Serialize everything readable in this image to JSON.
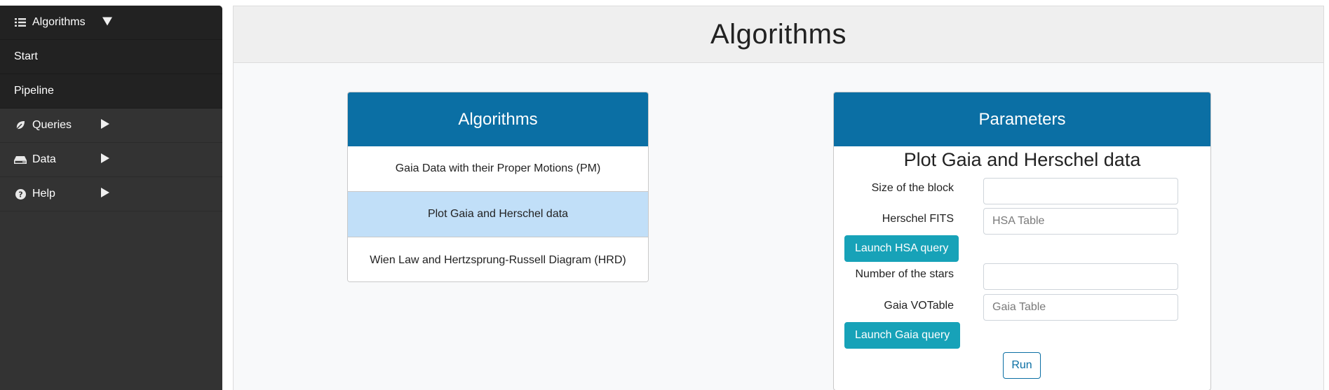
{
  "sidebar": {
    "algorithms": {
      "label": "Algorithms",
      "icon": "list-icon"
    },
    "start": {
      "label": "Start"
    },
    "pipeline": {
      "label": "Pipeline"
    },
    "queries": {
      "label": "Queries",
      "icon": "leaf-icon"
    },
    "data": {
      "label": "Data",
      "icon": "hdd-icon"
    },
    "help": {
      "label": "Help",
      "icon": "question-circle-icon"
    }
  },
  "header": {
    "title": "Algorithms"
  },
  "algorithms_card": {
    "title": "Algorithms",
    "items": [
      {
        "label": "Gaia Data with their Proper Motions (PM)"
      },
      {
        "label": "Plot Gaia and Herschel data"
      },
      {
        "label": "Wien Law and Hertzsprung-Russell Diagram (HRD)"
      }
    ],
    "active_index": 1
  },
  "parameters_card": {
    "title": "Parameters",
    "subtitle": "Plot Gaia and Herschel data",
    "block_size": {
      "label": "Size of the block",
      "value": "",
      "placeholder": ""
    },
    "herschel_fits": {
      "label": "Herschel FITS",
      "value": "",
      "placeholder": "HSA Table"
    },
    "launch_hsa": "Launch HSA query",
    "num_stars": {
      "label": "Number of the stars",
      "value": "",
      "placeholder": ""
    },
    "gaia_votable": {
      "label": "Gaia VOTable",
      "value": "",
      "placeholder": "Gaia Table"
    },
    "launch_gaia": "Launch Gaia query",
    "run": "Run"
  },
  "colors": {
    "sidebar_bg": "#333333",
    "sidebar_active_bg": "#222222",
    "card_header": "#0b6fa4",
    "selected_item": "#c1dff8",
    "teal_button": "#17a2b8"
  }
}
